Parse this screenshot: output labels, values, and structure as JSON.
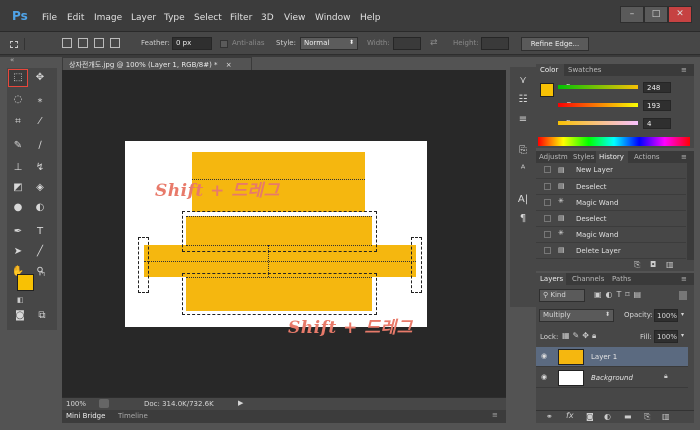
{
  "app": {
    "logo": "Ps",
    "menu": [
      "File",
      "Edit",
      "Image",
      "Layer",
      "Type",
      "Select",
      "Filter",
      "3D",
      "View",
      "Window",
      "Help"
    ],
    "window_buttons": [
      "–",
      "□",
      "✕"
    ]
  },
  "options_bar": {
    "feather_label": "Feather:",
    "feather_value": "0 px",
    "antialias_label": "Anti-alias",
    "style_label": "Style:",
    "style_value": "Normal",
    "width_label": "Width:",
    "height_label": "Height:",
    "refine_edge": "Refine Edge..."
  },
  "document": {
    "tab_title": "상자전개도.jpg @ 100% (Layer 1, RGB/8#) *",
    "tab_close": "×",
    "annotation_top": "Shift + 드레그",
    "annotation_bottom": "Shift + 드레그"
  },
  "status": {
    "zoom": "100%",
    "doc_size": "Doc: 314.0K/732.6K"
  },
  "bottom_tabs": [
    "Mini Bridge",
    "Timeline"
  ],
  "color_panel": {
    "tabs": [
      "Color",
      "Swatches"
    ],
    "r_label": "R",
    "r_value": "248",
    "g_label": "G",
    "g_value": "193",
    "b_label": "B",
    "b_value": "4",
    "foreground": "#f8c104"
  },
  "history_panel": {
    "tabs": [
      "Adjustm",
      "Styles",
      "History",
      "Actions"
    ],
    "items": [
      "New Layer",
      "Deselect",
      "Magic Wand",
      "Deselect",
      "Magic Wand",
      "Delete Layer"
    ]
  },
  "layers_panel": {
    "tabs": [
      "Layers",
      "Channels",
      "Paths"
    ],
    "kind_label": "Kind",
    "blend_mode": "Multiply",
    "opacity_label": "Opacity:",
    "opacity_value": "100%",
    "lock_label": "Lock:",
    "fill_label": "Fill:",
    "fill_value": "100%",
    "layers": [
      {
        "name": "Layer 1",
        "selected": true
      },
      {
        "name": "Background",
        "selected": false
      }
    ]
  },
  "colors": {
    "accent_orange": "#f5b70f",
    "annotation": "#e87a6a",
    "selected_tool_outline": "#e8473c"
  }
}
